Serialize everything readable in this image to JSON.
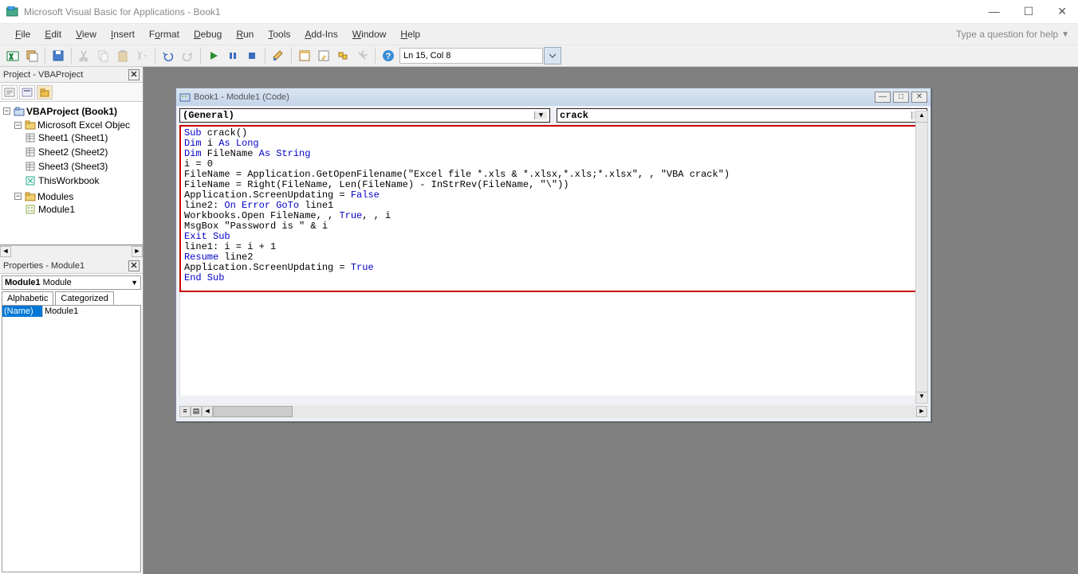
{
  "window": {
    "title": "Microsoft Visual Basic for Applications - Book1"
  },
  "menu": {
    "file": "File",
    "edit": "Edit",
    "view": "View",
    "insert": "Insert",
    "format": "Format",
    "debug": "Debug",
    "run": "Run",
    "tools": "Tools",
    "addins": "Add-Ins",
    "window": "Window",
    "help": "Help",
    "help_box": "Type a question for help"
  },
  "toolbar": {
    "position": "Ln 15, Col 8"
  },
  "project_pane": {
    "title": "Project - VBAProject",
    "root": "VBAProject (Book1)",
    "excel_folder": "Microsoft Excel Objec",
    "sheets": [
      "Sheet1 (Sheet1)",
      "Sheet2 (Sheet2)",
      "Sheet3 (Sheet3)"
    ],
    "thisworkbook": "ThisWorkbook",
    "modules_folder": "Modules",
    "module": "Module1"
  },
  "properties_pane": {
    "title": "Properties - Module1",
    "selector": "Module1 Module",
    "tabs": {
      "alpha": "Alphabetic",
      "cat": "Categorized"
    },
    "name_key": "(Name)",
    "name_val": "Module1"
  },
  "code_window": {
    "title": "Book1 - Module1 (Code)",
    "left_dd": "(General)",
    "right_dd": "crack",
    "code": {
      "l1a": "Sub",
      "l1b": " crack()",
      "l2a": "Dim",
      "l2b": " i ",
      "l2c": "As Long",
      "l3a": "Dim",
      "l3b": " FileName ",
      "l3c": "As String",
      "l4": "i = 0",
      "l5": "FileName = Application.GetOpenFilename(\"Excel file *.xls & *.xlsx,*.xls;*.xlsx\", , \"VBA crack\")",
      "l6": "FileName = Right(FileName, Len(FileName) - InStrRev(FileName, \"\\\"))",
      "l7a": "Application.ScreenUpdating = ",
      "l7b": "False",
      "l8a": "line2: ",
      "l8b": "On Error GoTo",
      "l8c": " line1",
      "l9a": "Workbooks.Open FileName, , ",
      "l9b": "True",
      "l9c": ", , i",
      "l10": "MsgBox \"Password is \" & i",
      "l11": "Exit Sub",
      "l12": "line1: i = i + 1",
      "l13a": "Resume",
      "l13b": " line2",
      "l14a": "Application.ScreenUpdating = ",
      "l14b": "True",
      "l15": "End Sub"
    }
  }
}
